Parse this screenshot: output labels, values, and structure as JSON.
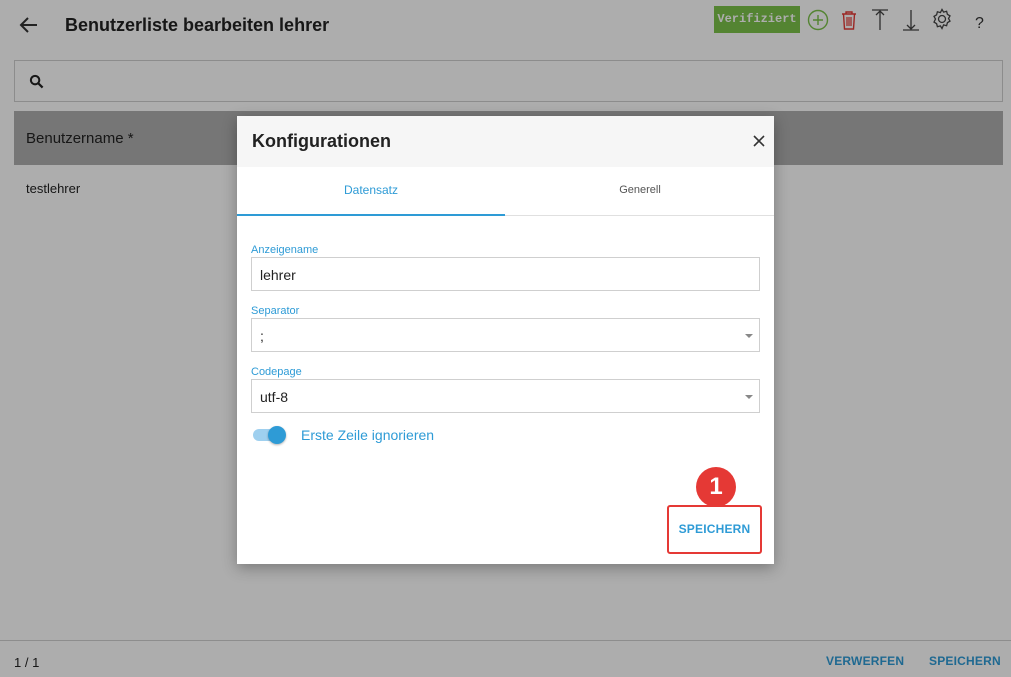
{
  "header": {
    "title": "Benutzerliste bearbeiten lehrer",
    "verified_label": "Verifiziert",
    "help_label": "?",
    "icons": [
      "back-arrow-icon",
      "add-circle-icon",
      "trash-icon",
      "upload-icon",
      "download-icon",
      "gear-icon"
    ]
  },
  "search": {
    "icon": "search-icon"
  },
  "table": {
    "columns": [
      "Benutzername *"
    ],
    "rows": [
      [
        "testlehrer"
      ]
    ]
  },
  "footer": {
    "pager": "1 / 1",
    "discard_label": "VERWERFEN",
    "save_label": "SPEICHERN"
  },
  "dialog": {
    "title": "Konfigurationen",
    "tabs": [
      "Datensatz",
      "Generell"
    ],
    "active_tab": "Datensatz",
    "fields": {
      "display_name": {
        "label": "Anzeigename",
        "value": "lehrer"
      },
      "separator": {
        "label": "Separator",
        "value": ";"
      },
      "codepage": {
        "label": "Codepage",
        "value": "utf-8"
      }
    },
    "toggle": {
      "label": "Erste Zeile ignorieren",
      "on": true
    },
    "save_label": "SPEICHERN",
    "callout_number": "1"
  },
  "colors": {
    "accent": "#2e9bd6",
    "verified": "#7cc34a",
    "danger": "#e53935",
    "table_header": "#aeaeae"
  }
}
